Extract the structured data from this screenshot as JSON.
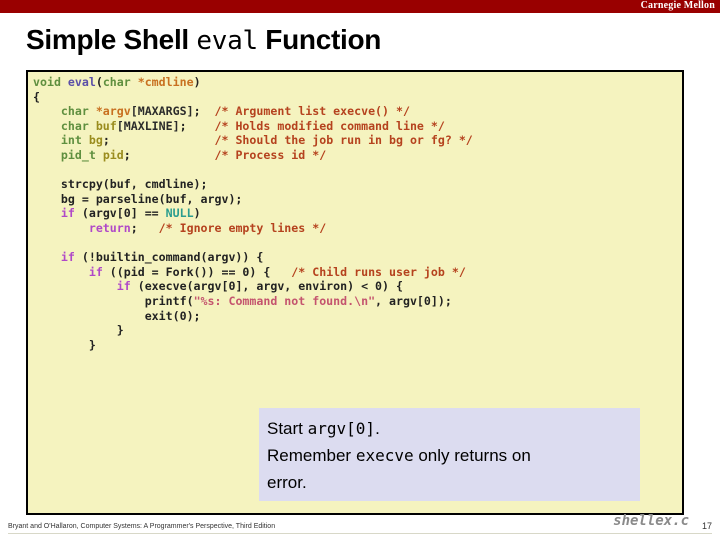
{
  "branding": {
    "wordmark": "Carnegie Mellon",
    "band_color": "#990000"
  },
  "slide": {
    "title_prefix": "Simple Shell ",
    "title_mono": "eval",
    "title_suffix": " Function",
    "page_number": "17",
    "filename_label": "shellex.c",
    "footer_note": "Bryant and O'Hallaron, Computer Systems: A Programmer's Perspective, Third Edition"
  },
  "code": {
    "language": "c",
    "background_color": "#f5f3bf",
    "lines": [
      "void eval(char *cmdline)",
      "{",
      "    char *argv[MAXARGS];  /* Argument list execve() */",
      "    char buf[MAXLINE];    /* Holds modified command line */",
      "    int bg;               /* Should the job run in bg or fg? */",
      "    pid_t pid;            /* Process id */",
      "",
      "    strcpy(buf, cmdline);",
      "    bg = parseline(buf, argv);",
      "    if (argv[0] == NULL)",
      "        return;   /* Ignore empty lines */",
      "",
      "    if (!builtin_command(argv)) {",
      "        if ((pid = Fork()) == 0) {   /* Child runs user job */",
      "            if (execve(argv[0], argv, environ) < 0) {",
      "                printf(\"%s: Command not found.\\n\", argv[0]);",
      "                exit(0);",
      "            }",
      "        }"
    ]
  },
  "callout": {
    "background_color": "#dcdcf0",
    "line1_prefix": "Start ",
    "line1_mono": "argv[0]",
    "line1_suffix": ".",
    "line2_prefix": "Remember ",
    "line2_mono": "execve",
    "line2_suffix": " only returns on",
    "line3": "error."
  }
}
